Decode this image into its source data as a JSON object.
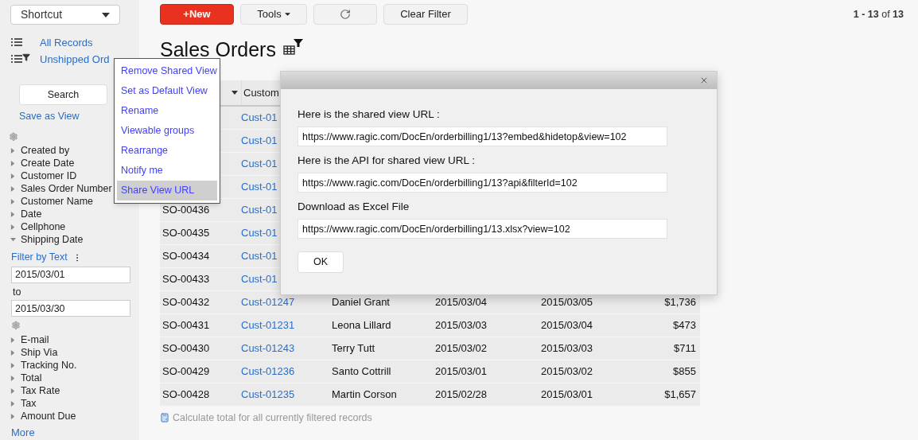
{
  "shortcut": {
    "label": "Shortcut"
  },
  "views": [
    {
      "label": "All Records",
      "filtered": false
    },
    {
      "label": "Unshipped Ord",
      "filtered": true
    }
  ],
  "search_button": "Search",
  "save_view": "Save as View",
  "fields": [
    {
      "label": "Created by",
      "expanded": false
    },
    {
      "label": "Create Date",
      "expanded": false
    },
    {
      "label": "Customer ID",
      "expanded": false
    },
    {
      "label": "Sales Order Number",
      "expanded": false
    },
    {
      "label": "Customer Name",
      "expanded": false
    },
    {
      "label": "Date",
      "expanded": false
    },
    {
      "label": "Cellphone",
      "expanded": false
    },
    {
      "label": "Shipping Date",
      "expanded": true
    }
  ],
  "filter": {
    "label": "Filter by Text",
    "from": "2015/03/01",
    "to_label": "to",
    "to": "2015/03/30"
  },
  "more_fields": [
    {
      "label": "E-mail",
      "expanded": false
    },
    {
      "label": "Ship Via",
      "expanded": false
    },
    {
      "label": "Tracking No.",
      "expanded": false
    },
    {
      "label": "Total",
      "expanded": false
    },
    {
      "label": "Tax Rate",
      "expanded": false
    },
    {
      "label": "Tax",
      "expanded": false
    },
    {
      "label": "Amount Due",
      "expanded": false
    }
  ],
  "more": "More",
  "toolbar": {
    "new": "+New",
    "tools": "Tools",
    "clear": "Clear Filter"
  },
  "pagination": "**1 - 13** of **13**",
  "title": "Sales Orders",
  "table": {
    "column_2": "Custom",
    "rows": [
      {
        "customer": "Cust-01"
      },
      {
        "customer": "Cust-01"
      },
      {
        "customer": "Cust-01"
      },
      {
        "customer": "Cust-01"
      },
      {
        "order": "SO-00436",
        "customer": "Cust-01"
      },
      {
        "order": "SO-00435",
        "customer": "Cust-01"
      },
      {
        "order": "SO-00434",
        "customer": "Cust-01"
      },
      {
        "order": "SO-00433",
        "customer": "Cust-01"
      },
      {
        "order": "SO-00432",
        "customer": "Cust-01247",
        "name": "Daniel Grant",
        "date": "2015/03/04",
        "ship": "2015/03/05",
        "total": "$1,736"
      },
      {
        "order": "SO-00431",
        "customer": "Cust-01231",
        "name": "Leona Lillard",
        "date": "2015/03/03",
        "ship": "2015/03/04",
        "total": "$473"
      },
      {
        "order": "SO-00430",
        "customer": "Cust-01243",
        "name": "Terry Tutt",
        "date": "2015/03/02",
        "ship": "2015/03/03",
        "total": "$711"
      },
      {
        "order": "SO-00429",
        "customer": "Cust-01236",
        "name": "Santo Cottrill",
        "date": "2015/03/01",
        "ship": "2015/03/02",
        "total": "$855"
      },
      {
        "order": "SO-00428",
        "customer": "Cust-01235",
        "name": "Martin Corson",
        "date": "2015/02/28",
        "ship": "2015/03/01",
        "total": "$1,657"
      }
    ]
  },
  "footer": "Calculate total for all currently filtered records",
  "menu": [
    {
      "label": "Remove Shared View",
      "selected": false
    },
    {
      "label": "Set as Default View",
      "selected": false
    },
    {
      "label": "Rename",
      "selected": false
    },
    {
      "label": "Viewable groups",
      "selected": false
    },
    {
      "label": "Rearrange",
      "selected": false
    },
    {
      "label": "Notify me",
      "selected": false
    },
    {
      "label": "Share View URL",
      "selected": true
    }
  ],
  "dialog": {
    "sections": [
      {
        "label": "Here is the shared view URL :",
        "url": "https://www.ragic.com/DocEn/orderbilling1/13?embed&hidetop&view=102"
      },
      {
        "label": "Here is the API for shared view URL :",
        "url": "https://www.ragic.com/DocEn/orderbilling1/13?api&filterId=102"
      },
      {
        "label": "Download as Excel File",
        "url": "https://www.ragic.com/DocEn/orderbilling1/13.xlsx?view=102"
      }
    ],
    "ok": "OK"
  }
}
